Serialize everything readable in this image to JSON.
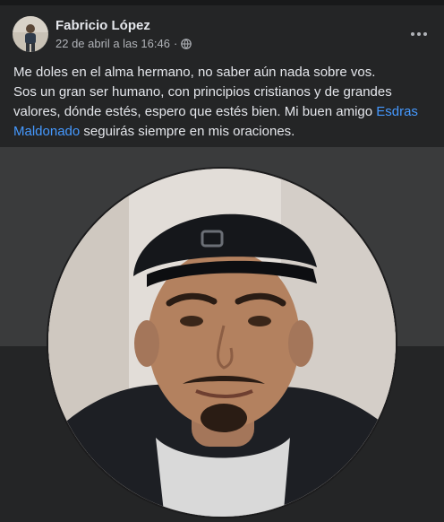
{
  "post": {
    "author": "Fabricio López",
    "timestamp": "22 de abril a las 16:46",
    "separator": "·",
    "privacy_icon": "globe-icon",
    "more_icon": "more-options-icon",
    "text": {
      "line1": "Me doles en el alma hermano, no saber aún nada sobre vos.",
      "line2_before": "Sos un gran ser humano, con principios cristianos y de grandes valores, dónde estés, espero que estés bien. Mi buen amigo ",
      "mention": "Esdras Maldonado",
      "line2_after": " seguirás siempre en mis oraciones."
    }
  },
  "colors": {
    "background": "#242526",
    "text": "#e4e6eb",
    "secondary_text": "#b0b3b8",
    "link": "#4599ff",
    "media_background": "#3a3b3c"
  }
}
